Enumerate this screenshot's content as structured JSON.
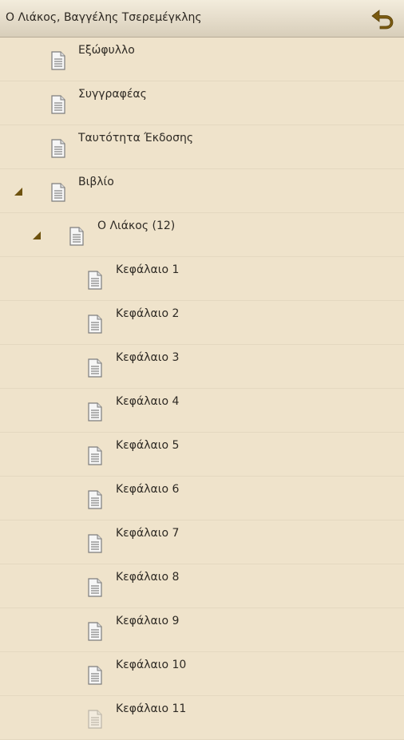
{
  "header": {
    "title": "Ο Λιάκος, Βαγγέλης Τσερεμέγκλης",
    "back_icon": "back-arrow-icon"
  },
  "tree": {
    "items": [
      {
        "label": "Εξώφυλλο",
        "icon": "document-icon"
      },
      {
        "label": "Συγγραφέας",
        "icon": "document-icon"
      },
      {
        "label": "Ταυτότητα Έκδοσης",
        "icon": "document-icon"
      },
      {
        "label": "Βιβλίο",
        "icon": "document-icon",
        "expanded": true
      },
      {
        "label": "Ο Λιάκος (12)",
        "icon": "document-icon",
        "expanded": true
      },
      {
        "label": "Κεφάλαιο 1",
        "icon": "document-icon"
      },
      {
        "label": "Κεφάλαιο 2",
        "icon": "document-icon"
      },
      {
        "label": "Κεφάλαιο 3",
        "icon": "document-icon"
      },
      {
        "label": "Κεφάλαιο 4",
        "icon": "document-icon"
      },
      {
        "label": "Κεφάλαιο 5",
        "icon": "document-icon"
      },
      {
        "label": "Κεφάλαιο 6",
        "icon": "document-icon"
      },
      {
        "label": "Κεφάλαιο 7",
        "icon": "document-icon"
      },
      {
        "label": "Κεφάλαιο 8",
        "icon": "document-icon"
      },
      {
        "label": "Κεφάλαιο 9",
        "icon": "document-icon"
      },
      {
        "label": "Κεφάλαιο 10",
        "icon": "document-icon"
      },
      {
        "label": "Κεφάλαιο 11",
        "icon": "document-icon"
      }
    ]
  },
  "colors": {
    "background": "#efe3cb",
    "accent": "#7a5a10",
    "text": "#2e2a24"
  }
}
